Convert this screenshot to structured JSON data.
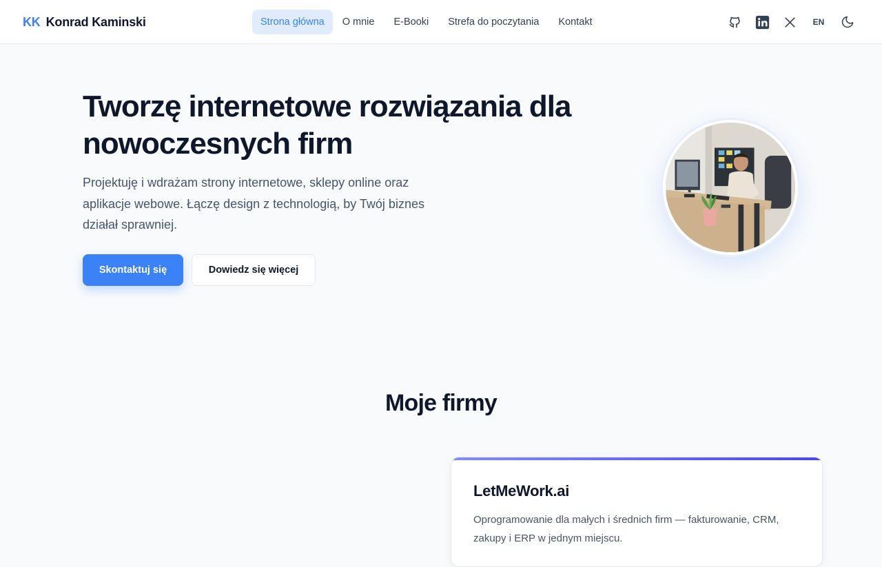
{
  "header": {
    "logo_mark": "KK",
    "logo_name": "Konrad Kaminski",
    "nav": [
      {
        "label": "Strona główna",
        "active": true
      },
      {
        "label": "O mnie"
      },
      {
        "label": "E-Booki"
      },
      {
        "label": "Strefa do poczytania"
      },
      {
        "label": "Kontakt"
      }
    ],
    "actions": {
      "github_icon": "github-icon",
      "linkedin_icon": "linkedin-icon",
      "x_icon": "x-logo-icon",
      "language": "EN",
      "theme_icon": "moon-icon"
    }
  },
  "hero": {
    "title": "Tworzę internetowe rozwiązania dla nowoczesnych firm",
    "subtitle": "Projektuję i wdrażam strony internetowe, sklepy online oraz aplikacje webowe. Łączę design z technologią, by Twój biznes działał sprawniej.",
    "primary_button": "Skontaktuj się",
    "secondary_button": "Dowiedz się więcej"
  },
  "companies": {
    "title": "Moje firmy",
    "cards": [
      {
        "name": "LetMeWork.ai",
        "description": "Oprogramowanie dla małych i średnich firm — fakturowanie, CRM, zakupy i ERP w jednym miejscu."
      }
    ]
  },
  "colors": {
    "accent": "#3b82f6",
    "text": "#0f172a",
    "muted": "#475569",
    "background": "#f8fafc"
  }
}
